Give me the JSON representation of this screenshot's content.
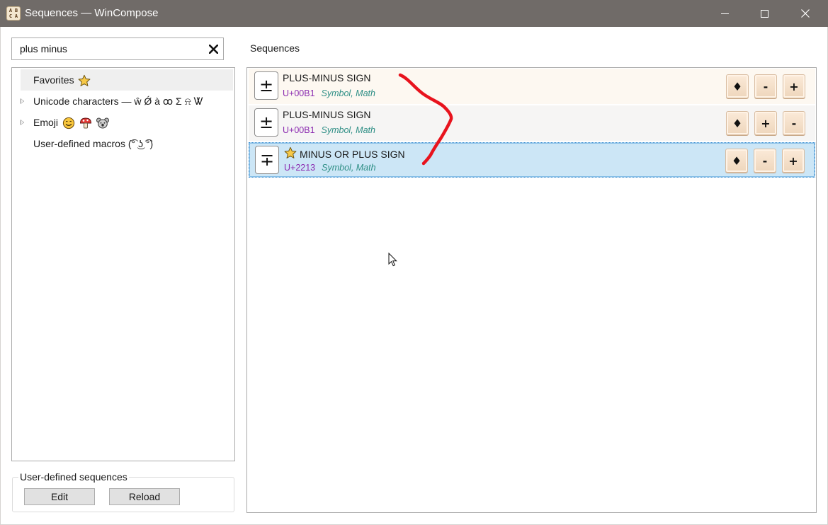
{
  "window": {
    "title": "Sequences — WinCompose",
    "app_icon_letters": [
      "A",
      "B",
      "C",
      "A"
    ]
  },
  "search": {
    "value": "plus minus",
    "clear_icon": "close-icon"
  },
  "categories": [
    {
      "label": "Favorites",
      "icon": "star-icon",
      "expandable": false,
      "selected": true
    },
    {
      "label": "Unicode characters — ŵ Ǿ à ꝏ Σ ⍾ Ꮤ",
      "expandable": true,
      "selected": false
    },
    {
      "label": "Emoji",
      "icons": [
        "smiley-face-icon",
        "mushroom-icon",
        "koala-icon"
      ],
      "expandable": true,
      "selected": false
    },
    {
      "label": "User-defined macros (͡° ͜ʖ ͡°)",
      "expandable": false,
      "selected": false
    }
  ],
  "user_defined": {
    "legend": "User-defined sequences",
    "edit_label": "Edit",
    "reload_label": "Reload"
  },
  "sequences": {
    "heading": "Sequences",
    "rows": [
      {
        "char": "±",
        "name": "PLUS-MINUS SIGN",
        "code": "U+00B1",
        "category": "Symbol, Math",
        "favorite": false,
        "keys": [
          "♦",
          "-",
          "+"
        ]
      },
      {
        "char": "±",
        "name": "PLUS-MINUS SIGN",
        "code": "U+00B1",
        "category": "Symbol, Math",
        "favorite": false,
        "keys": [
          "♦",
          "+",
          "-"
        ]
      },
      {
        "char": "∓",
        "name": "MINUS OR PLUS SIGN",
        "code": "U+2213",
        "category": "Symbol, Math",
        "favorite": true,
        "keys": [
          "♦",
          "-",
          "+"
        ]
      }
    ]
  },
  "colors": {
    "titlebar": "#706b68",
    "selected_row": "#cce6f6",
    "codepoint": "#8b2bb0",
    "category": "#2f8f86",
    "annotation": "#e8131d"
  }
}
